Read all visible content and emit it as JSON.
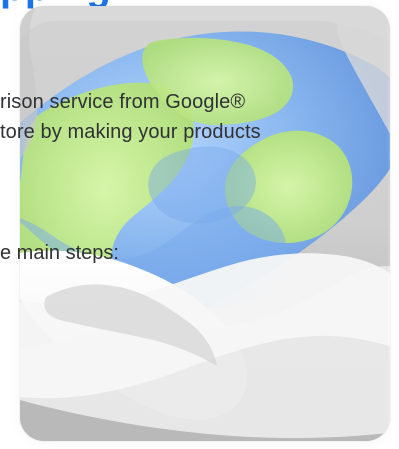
{
  "page": {
    "title_partial": "pping"
  },
  "content": {
    "paragraph_lines": [
      "rison service from Google®",
      "tore by making your products"
    ],
    "steps_intro": "e main steps:"
  },
  "colors": {
    "title": "#1a73e8",
    "text": "#303134",
    "modal_light": "#d0d0d0",
    "modal_dark": "#a9a9a9"
  },
  "illustration": {
    "icon_name": "globe-icon"
  }
}
